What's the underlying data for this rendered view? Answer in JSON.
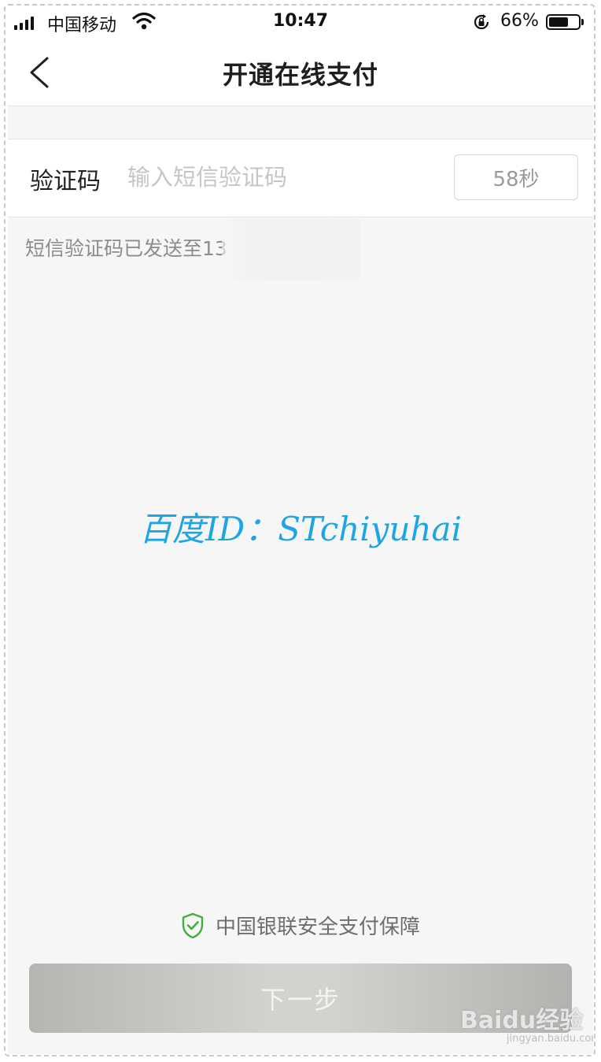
{
  "status_bar": {
    "carrier": "中国移动",
    "time": "10:47",
    "battery_percent": "66%",
    "battery_level": 0.66
  },
  "nav": {
    "title": "开通在线支付"
  },
  "form": {
    "code_label": "验证码",
    "code_placeholder": "输入短信验证码",
    "code_value": "",
    "countdown": "58秒",
    "sms_note": "短信验证码已发送至13"
  },
  "watermark": {
    "text": "百度ID：STchiyuhai"
  },
  "footer": {
    "security_text": "中国银联安全支付保障",
    "next_button": "下一步"
  },
  "brand": {
    "logo_text": "Baidu经验",
    "url": "jingyan.baidu.com"
  },
  "colors": {
    "watermark": "#1ea5e6",
    "shield": "#3fae3f",
    "button_disabled": "#c4c5c1"
  }
}
